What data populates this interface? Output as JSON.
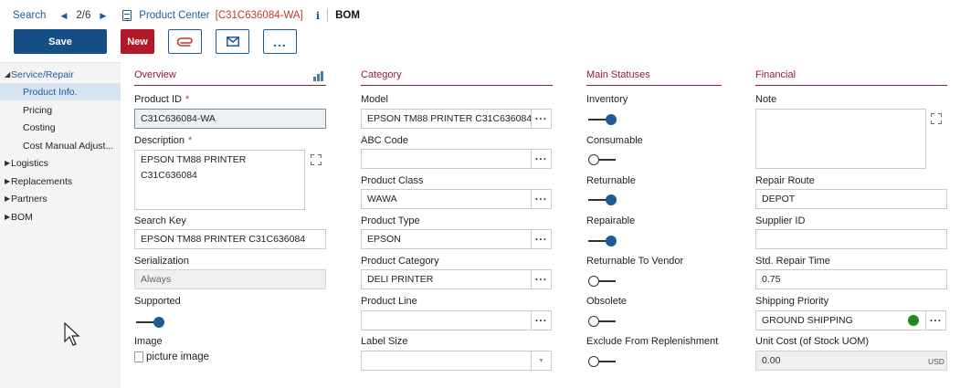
{
  "nav": {
    "search": "Search",
    "pager": "2/6",
    "title_main": "Product Center",
    "title_id": "[C31C636084-WA]",
    "info": "i",
    "breadcrumb_extra": "BOM"
  },
  "toolbar": {
    "save_label": "Save",
    "new_label": "New",
    "more_label": "..."
  },
  "sidebar": {
    "items": [
      {
        "label": "Service/Repair",
        "expanded": true
      },
      {
        "label": "Product Info.",
        "active": true
      },
      {
        "label": "Pricing"
      },
      {
        "label": "Costing"
      },
      {
        "label": "Cost Manual Adjust..."
      },
      {
        "label": "Logistics"
      },
      {
        "label": "Replacements"
      },
      {
        "label": "Partners"
      },
      {
        "label": "BOM"
      }
    ]
  },
  "sections": {
    "overview": "Overview",
    "category": "Category",
    "statuses": "Main Statuses",
    "financial": "Financial"
  },
  "overview": {
    "product_id_label": "Product ID",
    "product_id": "C31C636084-WA",
    "description_label": "Description",
    "description_line1": "EPSON TM88 PRINTER",
    "description_line2": "C31C636084",
    "search_key_label": "Search Key",
    "search_key": "EPSON TM88 PRINTER C31C636084",
    "serialization_label": "Serialization",
    "serialization": "Always",
    "supported_label": "Supported",
    "supported": true,
    "image_label": "Image",
    "image_alt": "picture image",
    "required_mark": "*"
  },
  "category": {
    "model_label": "Model",
    "model": "EPSON TM88 PRINTER C31C636084",
    "abc_label": "ABC Code",
    "abc": "",
    "class_label": "Product Class",
    "class": "WAWA",
    "type_label": "Product Type",
    "type": "EPSON",
    "pcat_label": "Product Category",
    "pcat": "DELI PRINTER",
    "line_label": "Product Line",
    "line": "",
    "label_size_label": "Label Size",
    "label_size": ""
  },
  "statuses": [
    {
      "label": "Inventory",
      "on": true
    },
    {
      "label": "Consumable",
      "on": false
    },
    {
      "label": "Returnable",
      "on": true
    },
    {
      "label": "Repairable",
      "on": true
    },
    {
      "label": "Returnable To Vendor",
      "on": false
    },
    {
      "label": "Obsolete",
      "on": false
    },
    {
      "label": "Exclude From Replenishment",
      "on": false
    }
  ],
  "financial": {
    "note_label": "Note",
    "note": "",
    "repair_route_label": "Repair Route",
    "repair_route": "DEPOT",
    "supplier_label": "Supplier ID",
    "supplier": "",
    "repair_time_label": "Std. Repair Time",
    "repair_time": "0.75",
    "shipping_label": "Shipping Priority",
    "shipping": "GROUND SHIPPING",
    "shipping_status_color": "#1e8a1e",
    "unit_cost_label": "Unit Cost (of Stock UOM)",
    "unit_cost": "0.00",
    "unit_cost_currency": "USD"
  },
  "colors": {
    "accent": "#1f5a94",
    "save": "#154d85",
    "new": "#b3172a",
    "section": "#9b1b30"
  }
}
